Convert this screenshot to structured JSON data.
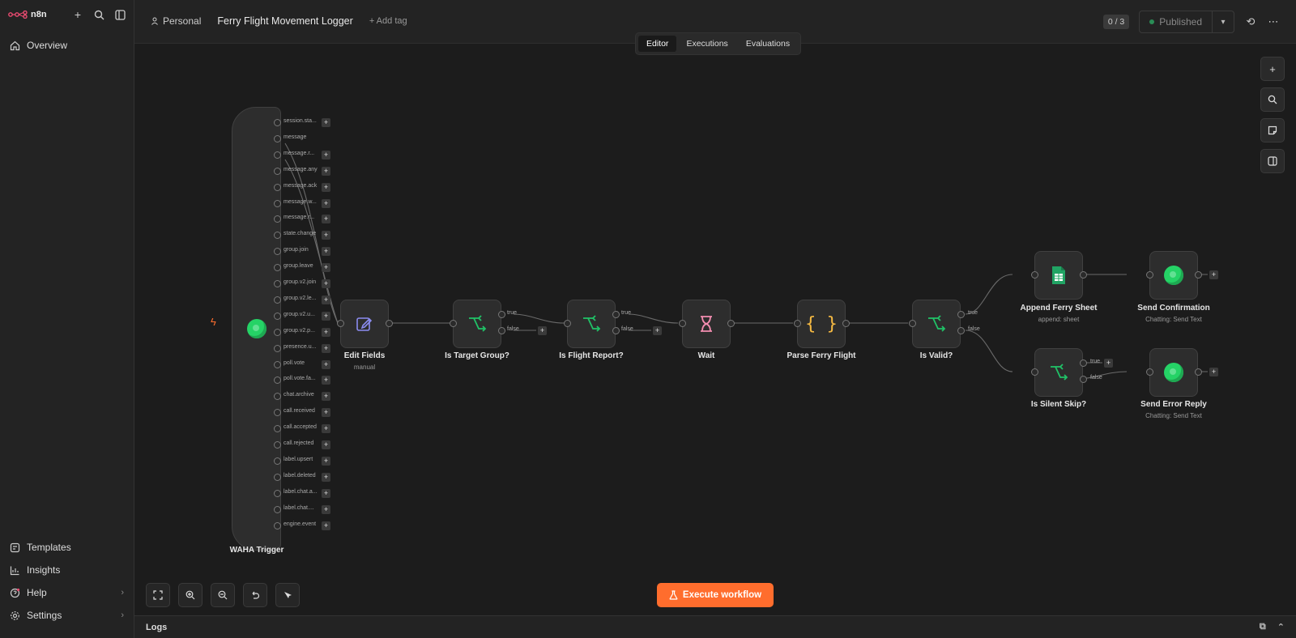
{
  "sidebar": {
    "brand": "n8n",
    "top_items": [
      {
        "label": "Overview",
        "icon": "home-icon"
      }
    ],
    "bottom_items": [
      {
        "label": "Templates",
        "icon": "templates-icon"
      },
      {
        "label": "Insights",
        "icon": "insights-icon"
      },
      {
        "label": "Help",
        "icon": "help-icon"
      },
      {
        "label": "Settings",
        "icon": "settings-icon"
      }
    ]
  },
  "header": {
    "project": "Personal",
    "workflow_name": "Ferry Flight Movement Logger",
    "add_tag": "+ Add tag",
    "counter": "0 / 3",
    "publish_label": "Published"
  },
  "tabs": [
    "Editor",
    "Executions",
    "Evaluations"
  ],
  "trigger": {
    "label": "WAHA Trigger",
    "outputs": [
      "session.sta...",
      "message",
      "message.r...",
      "message.any",
      "message.ack",
      "message.w...",
      "message.r...",
      "state.change",
      "group.join",
      "group.leave",
      "group.v2.join",
      "group.v2.le...",
      "group.v2.u...",
      "group.v2.p...",
      "presence.u...",
      "poll.vote",
      "poll.vote.fa...",
      "chat.archive",
      "call.received",
      "call.accepted",
      "call.rejected",
      "label.upsert",
      "label.deleted",
      "label.chat.a...",
      "label.chat....",
      "engine.event"
    ]
  },
  "nodes": {
    "edit_fields": {
      "label": "Edit Fields",
      "sub": "manual"
    },
    "is_target": {
      "label": "Is Target Group?"
    },
    "is_flight": {
      "label": "Is Flight Report?"
    },
    "wait": {
      "label": "Wait"
    },
    "parse": {
      "label": "Parse Ferry Flight"
    },
    "is_valid": {
      "label": "Is Valid?"
    },
    "append": {
      "label": "Append Ferry Sheet",
      "sub": "append: sheet"
    },
    "send_conf": {
      "label": "Send Confirmation",
      "sub": "Chatting: Send Text"
    },
    "silent": {
      "label": "Is Silent Skip?"
    },
    "send_err": {
      "label": "Send Error Reply",
      "sub": "Chatting: Send Text"
    }
  },
  "branches": {
    "true": "true",
    "false": "false"
  },
  "execute_label": "Execute workflow",
  "logs_label": "Logs",
  "colors": {
    "accent": "#ff6d2d",
    "whatsapp": "#25d366",
    "if_green": "#20c267",
    "wait_pink": "#f38db0",
    "code_orange": "#f5b942"
  }
}
